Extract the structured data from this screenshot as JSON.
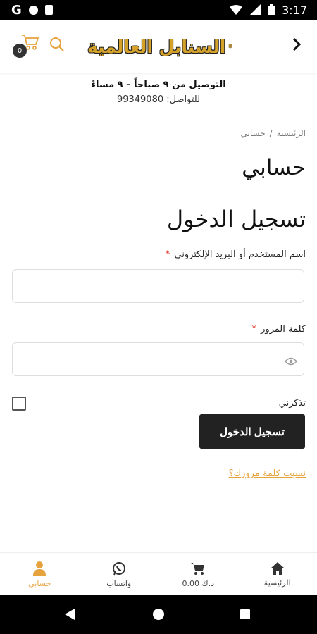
{
  "status_bar": {
    "time": "3:17",
    "g_icon": "G"
  },
  "header": {
    "cart_count": "0",
    "logo_text": "السنابل العالمية",
    "brand_color": "#d4a12a",
    "accent_color": "#e6a23c"
  },
  "info": {
    "delivery": "التوصيل من ٩ صباحاً – ٩ مساءً",
    "contact": "للتواصل: 99349080"
  },
  "breadcrumb": {
    "home": "الرئيسية",
    "separator": "/",
    "current": "حسابي"
  },
  "page_title": "حسابي",
  "login": {
    "heading": "تسجيل الدخول",
    "username_label": "اسم المستخدم أو البريد الإلكتروني",
    "username_value": "",
    "password_label": "كلمة المرور",
    "password_value": "",
    "required_mark": "*",
    "remember_label": "تذكرني",
    "submit_label": "تسجيل الدخول",
    "forgot_link": "نسيت كلمة مرورك؟"
  },
  "bottom_nav": {
    "home": "الرئيسية",
    "cart": "0.00 د.ك",
    "whatsapp": "واتساب",
    "account": "حسابي"
  }
}
